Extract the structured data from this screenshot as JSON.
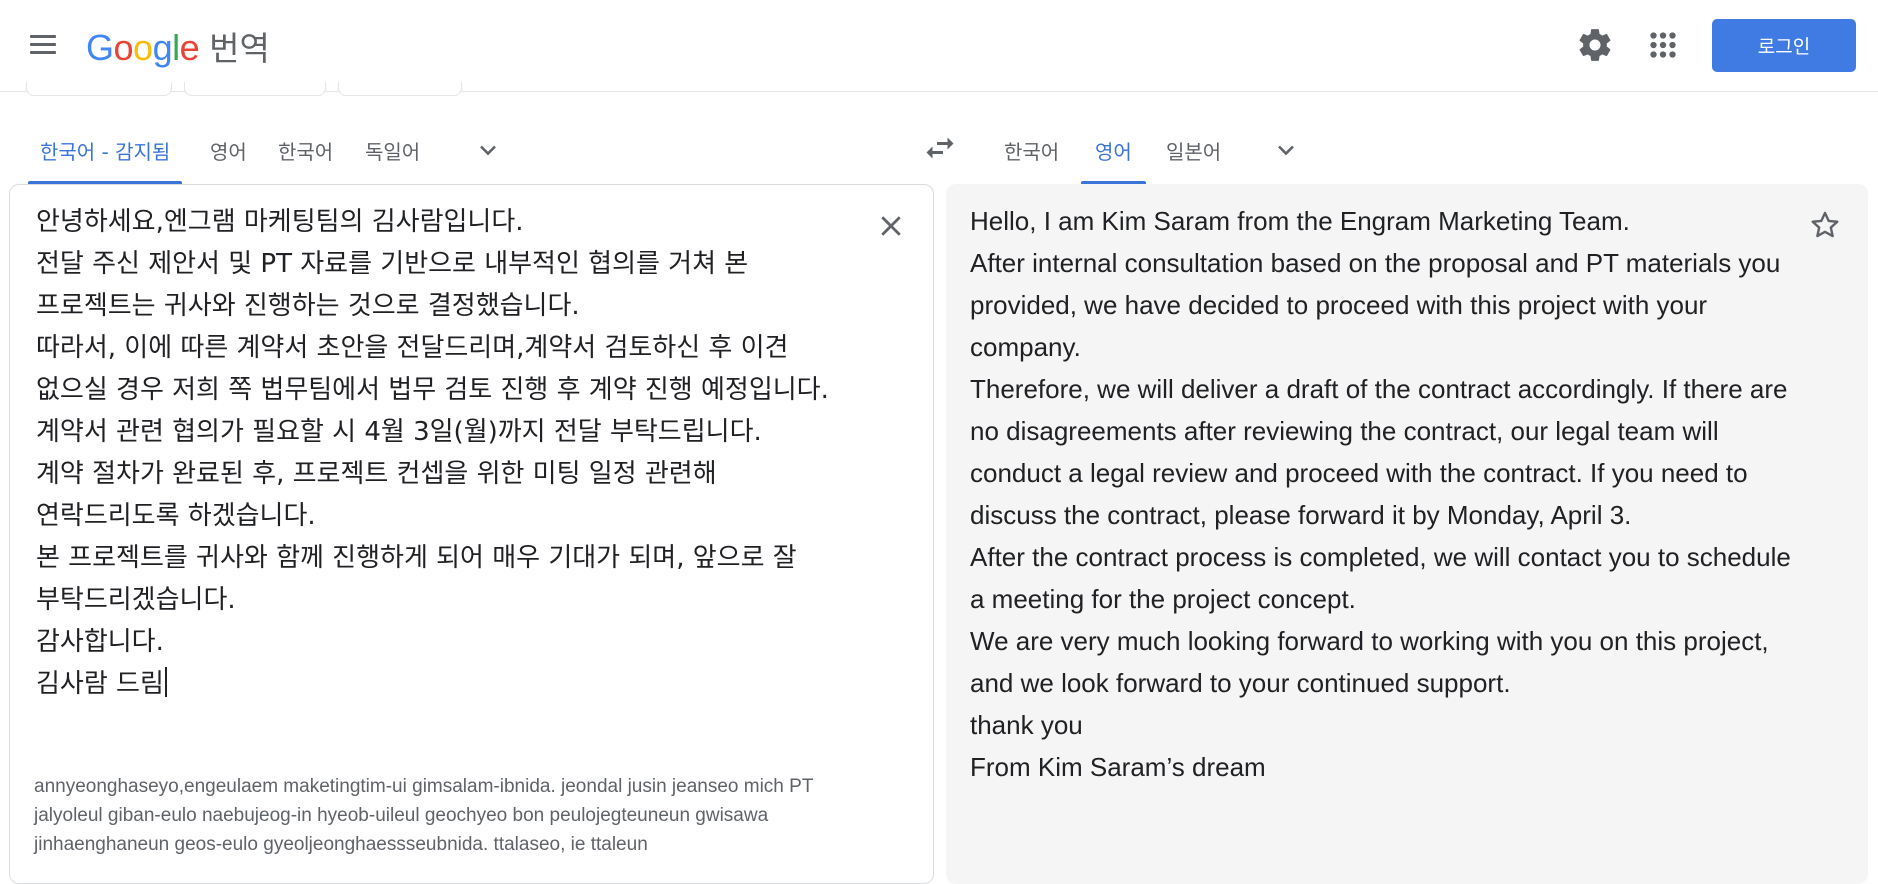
{
  "header": {
    "logo_letters": [
      "G",
      "o",
      "o",
      "g",
      "l",
      "e"
    ],
    "logo_colors": [
      "#4285f4",
      "#ea4335",
      "#fbbc05",
      "#4285f4",
      "#34a853",
      "#ea4335"
    ],
    "product_name": "번역",
    "login_label": "로그인",
    "menu_icon": "hamburger-menu-icon",
    "settings_icon": "gear-icon",
    "apps_icon": "apps-grid-icon"
  },
  "source": {
    "tabs": [
      {
        "label": "한국어 - 감지됨",
        "active": true
      },
      {
        "label": "영어",
        "active": false
      },
      {
        "label": "한국어",
        "active": false
      },
      {
        "label": "독일어",
        "active": false
      }
    ],
    "lines": [
      "안녕하세요,엔그램 마케팅팀의 김사람입니다.",
      "전달 주신 제안서 및 PT 자료를 기반으로 내부적인 협의를 거쳐 본 프로젝트는 귀사와 진행하는 것으로 결정했습니다.",
      "따라서, 이에 따른 계약서 초안을 전달드리며,계약서 검토하신 후 이견 없으실 경우 저희 쪽 법무팀에서 법무 검토 진행 후 계약 진행 예정입니다.계약서 관련 협의가 필요할 시 4월 3일(월)까지 전달 부탁드립니다.",
      "계약 절차가 완료된 후, 프로젝트 컨셉을 위한 미팅 일정 관련해 연락드리도록 하겠습니다.",
      "본 프로젝트를 귀사와 함께 진행하게 되어 매우 기대가 되며, 앞으로 잘 부탁드리겠습니다.",
      "감사합니다.",
      "김사람 드림"
    ],
    "romanization": "annyeonghaseyo,engeulaem maketingtim-ui gimsalam-ibnida. jeondal jusin jeanseo mich PT jalyoleul giban-eulo naebujeog-in hyeob-uileul geochyeo bon peulojegteuneun gwisawa jinhaenghaneun geos-eulo gyeoljeonghaessseubnida. ttalaseo, ie ttaleun"
  },
  "target": {
    "tabs": [
      {
        "label": "한국어",
        "active": false
      },
      {
        "label": "영어",
        "active": true
      },
      {
        "label": "일본어",
        "active": false
      }
    ],
    "lines": [
      "Hello, I am Kim Saram from the Engram Marketing Team.",
      "After internal consultation based on the proposal and PT materials you provided, we have decided to proceed with this project with your company.",
      "Therefore, we will deliver a draft of the contract accordingly. If there are no disagreements after reviewing the contract, our legal team will conduct a legal review and proceed with the contract. If you need to discuss the contract, please forward it by Monday, April 3.",
      "After the contract process is completed, we will contact you to schedule a meeting for the project concept.",
      "We are very much looking forward to working with you on this project, and we look forward to your continued support.",
      "thank you",
      "From Kim Saram’s dream"
    ]
  },
  "icons": {
    "swap": "swap-languages-icon",
    "clear": "close-icon",
    "star": "star-icon",
    "more_languages": "chevron-down-icon"
  },
  "colors": {
    "accent": "#3b74d8",
    "login_button": "#3f7be3",
    "target_panel_bg": "#f5f5f5"
  }
}
